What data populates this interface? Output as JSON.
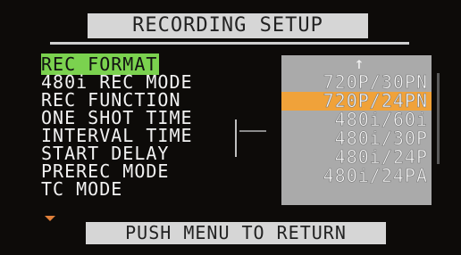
{
  "title": "RECORDING SETUP",
  "menu": {
    "items": [
      {
        "label": "REC FORMAT",
        "selected": true
      },
      {
        "label": "480i REC MODE",
        "selected": false
      },
      {
        "label": "REC FUNCTION",
        "selected": false
      },
      {
        "label": "ONE SHOT TIME",
        "selected": false
      },
      {
        "label": "INTERVAL TIME",
        "selected": false
      },
      {
        "label": "START DELAY",
        "selected": false
      },
      {
        "label": "PREREC MODE",
        "selected": false
      },
      {
        "label": "TC MODE",
        "selected": false
      }
    ]
  },
  "options": {
    "up_icon": "↑",
    "items": [
      {
        "label": "720P/30PN",
        "selected": false
      },
      {
        "label": "720P/24PN",
        "selected": true
      },
      {
        "label": "480i/60i",
        "selected": false
      },
      {
        "label": "480i/30P",
        "selected": false
      },
      {
        "label": "480i/24P",
        "selected": false
      },
      {
        "label": "480i/24PA",
        "selected": false
      }
    ]
  },
  "footer": "PUSH MENU TO RETURN",
  "colors": {
    "background": "#0d0b09",
    "selected_menu": "#7bd24f",
    "selected_option": "#f0a23a",
    "panel": "#aaaaaa",
    "bar": "#d6d6d6"
  }
}
